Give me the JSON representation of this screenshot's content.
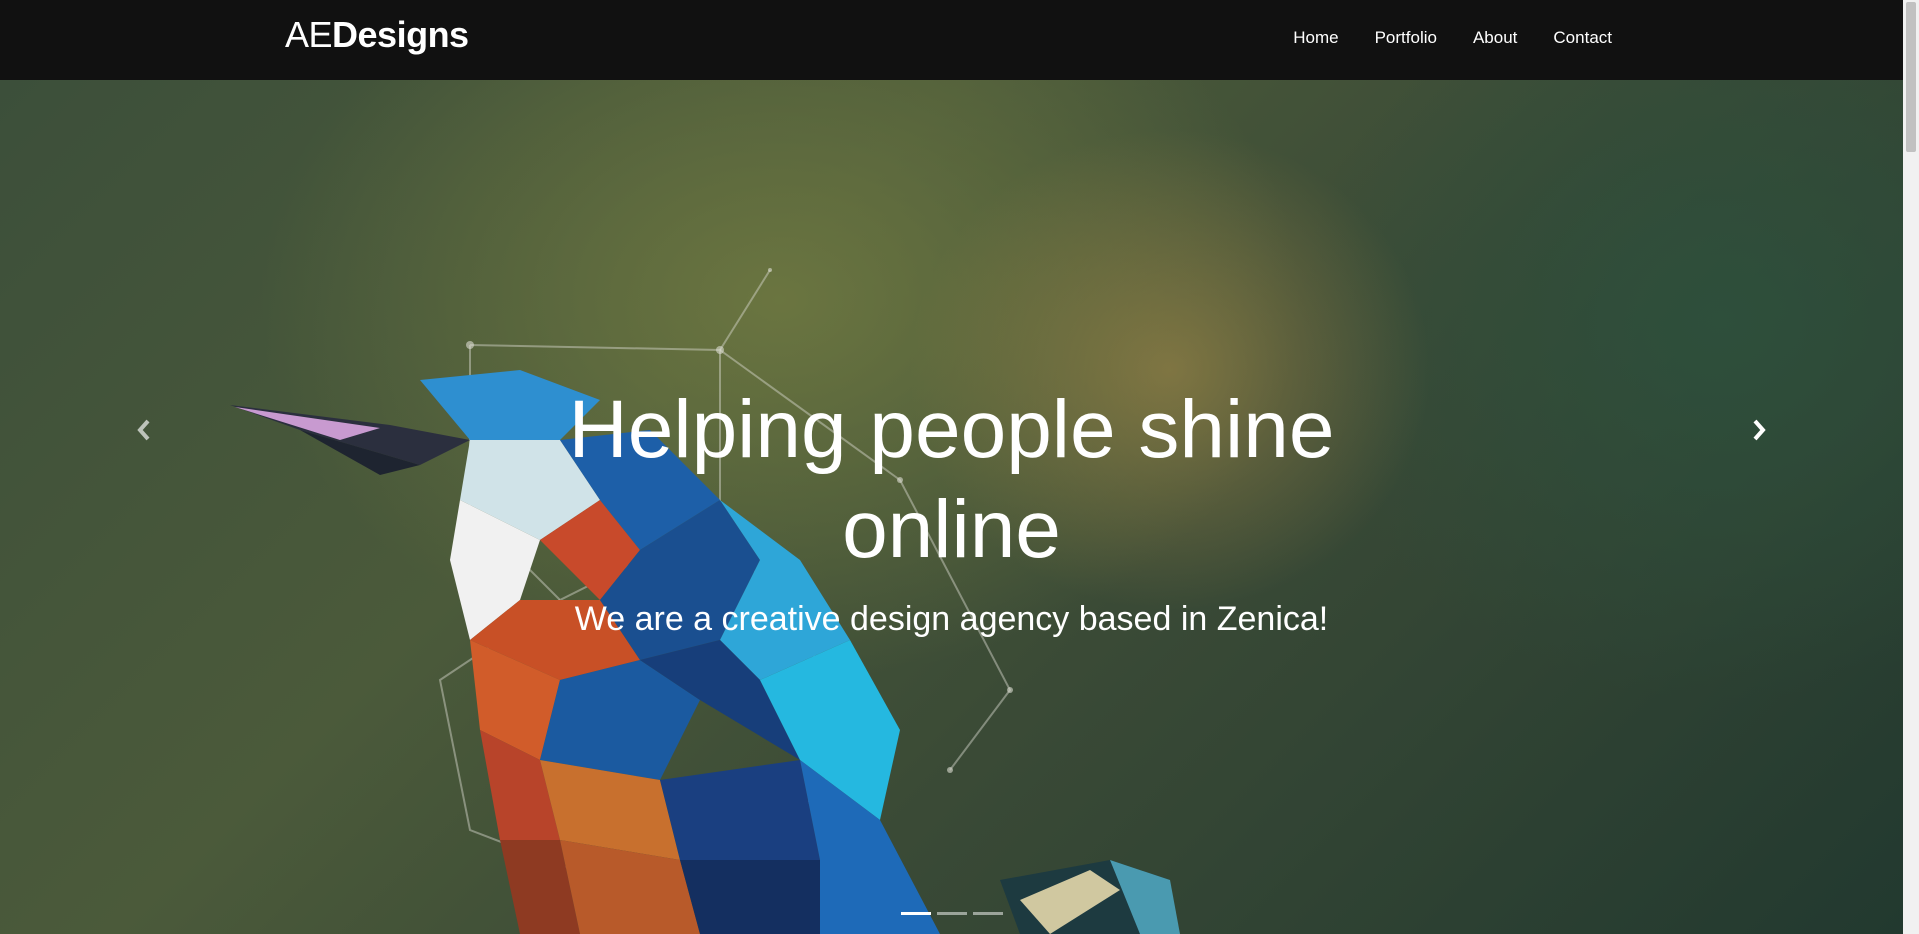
{
  "brand": {
    "light": "AE",
    "bold": "Designs"
  },
  "nav": {
    "items": [
      "Home",
      "Portfolio",
      "About",
      "Contact"
    ]
  },
  "hero": {
    "headline": "Helping people shine online",
    "tagline": "We are a creative design agency based in Zenica!"
  },
  "carousel": {
    "slide_count": 3,
    "active_index": 0,
    "prev_icon": "chevron-left-icon",
    "next_icon": "chevron-right-icon"
  },
  "colors": {
    "navbar": "#111111",
    "text": "#ffffff"
  }
}
